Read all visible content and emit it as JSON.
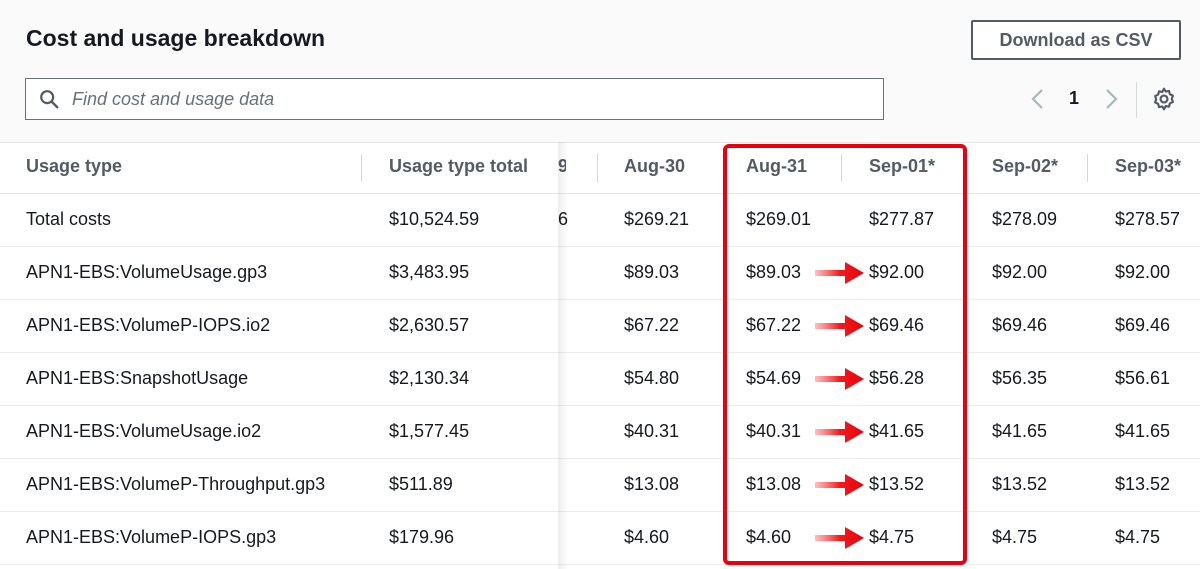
{
  "header": {
    "title": "Cost and usage breakdown",
    "download_label": "Download as CSV"
  },
  "search": {
    "placeholder": "Find cost and usage data",
    "value": ""
  },
  "pagination": {
    "current_page": "1"
  },
  "table": {
    "columns": [
      {
        "label": "Usage type"
      },
      {
        "label": "Usage type total"
      },
      {
        "label": "9"
      },
      {
        "label": "Aug-30"
      },
      {
        "label": "Aug-31"
      },
      {
        "label": "Sep-01*"
      },
      {
        "label": "Sep-02*"
      },
      {
        "label": "Sep-03*"
      }
    ],
    "rows": [
      {
        "name": "Total costs",
        "total": "$10,524.59",
        "clip": "6",
        "d1": "$269.21",
        "d2": "$269.01",
        "d3": "$277.87",
        "d4": "$278.09",
        "d5": "$278.57"
      },
      {
        "name": "APN1-EBS:VolumeUsage.gp3",
        "total": "$3,483.95",
        "clip": "",
        "d1": "$89.03",
        "d2": "$89.03",
        "d3": "$92.00",
        "d4": "$92.00",
        "d5": "$92.00"
      },
      {
        "name": "APN1-EBS:VolumeP-IOPS.io2",
        "total": "$2,630.57",
        "clip": "",
        "d1": "$67.22",
        "d2": "$67.22",
        "d3": "$69.46",
        "d4": "$69.46",
        "d5": "$69.46"
      },
      {
        "name": "APN1-EBS:SnapshotUsage",
        "total": "$2,130.34",
        "clip": "",
        "d1": "$54.80",
        "d2": "$54.69",
        "d3": "$56.28",
        "d4": "$56.35",
        "d5": "$56.61"
      },
      {
        "name": "APN1-EBS:VolumeUsage.io2",
        "total": "$1,577.45",
        "clip": "",
        "d1": "$40.31",
        "d2": "$40.31",
        "d3": "$41.65",
        "d4": "$41.65",
        "d5": "$41.65"
      },
      {
        "name": "APN1-EBS:VolumeP-Throughput.gp3",
        "total": "$511.89",
        "clip": "",
        "d1": "$13.08",
        "d2": "$13.08",
        "d3": "$13.52",
        "d4": "$13.52",
        "d5": "$13.52"
      },
      {
        "name": "APN1-EBS:VolumeP-IOPS.gp3",
        "total": "$179.96",
        "clip": "",
        "d1": "$4.60",
        "d2": "$4.60",
        "d3": "$4.75",
        "d4": "$4.75",
        "d5": "$4.75"
      }
    ]
  },
  "annotation": {
    "color": "#e8000d"
  },
  "icons": {
    "search": "search-icon",
    "prev": "chevron-left-icon",
    "next": "chevron-right-icon",
    "settings": "gear-icon",
    "arrow": "right-arrow-icon"
  }
}
